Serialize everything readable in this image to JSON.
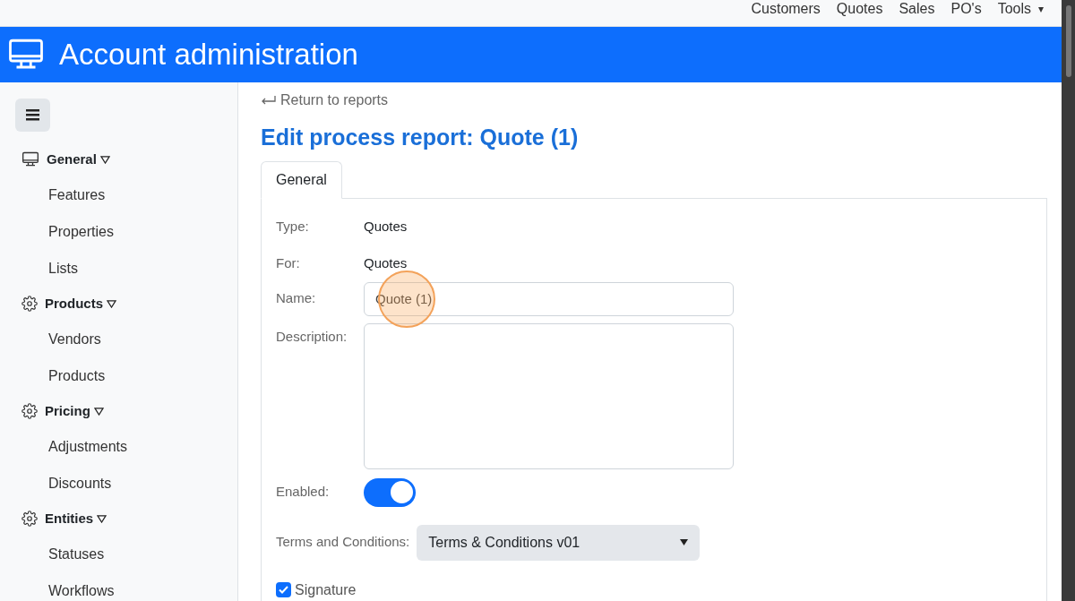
{
  "top_nav": {
    "items": [
      "Customers",
      "Quotes",
      "Sales",
      "PO's",
      "Tools"
    ],
    "dropdown_caret": "▾"
  },
  "header": {
    "title": "Account administration"
  },
  "sidebar": {
    "sections": [
      {
        "label": "General",
        "kind": "monitor",
        "expanded": true,
        "children": [
          {
            "label": "Features"
          },
          {
            "label": "Properties"
          },
          {
            "label": "Lists"
          }
        ]
      },
      {
        "label": "Products",
        "kind": "gear",
        "expanded": true,
        "children": [
          {
            "label": "Vendors"
          },
          {
            "label": "Products"
          }
        ]
      },
      {
        "label": "Pricing",
        "kind": "gear",
        "expanded": true,
        "children": [
          {
            "label": "Adjustments"
          },
          {
            "label": "Discounts"
          }
        ]
      },
      {
        "label": "Entities",
        "kind": "gear",
        "expanded": true,
        "children": [
          {
            "label": "Statuses"
          },
          {
            "label": "Workflows"
          }
        ]
      }
    ]
  },
  "back_link": "Return to reports",
  "page_title": "Edit process report: Quote (1)",
  "tabs": [
    {
      "label": "General",
      "selected": true
    }
  ],
  "form": {
    "type_label": "Type:",
    "type_value": "Quotes",
    "for_label": "For:",
    "for_value": "Quotes",
    "name_label": "Name:",
    "name_value": "Quote (1)",
    "description_label": "Description:",
    "enabled_label": "Enabled:",
    "enabled": true,
    "terms_label": "Terms and Conditions:",
    "terms_value": "Terms & Conditions v01",
    "signature_label": "Signature",
    "signature": true
  }
}
